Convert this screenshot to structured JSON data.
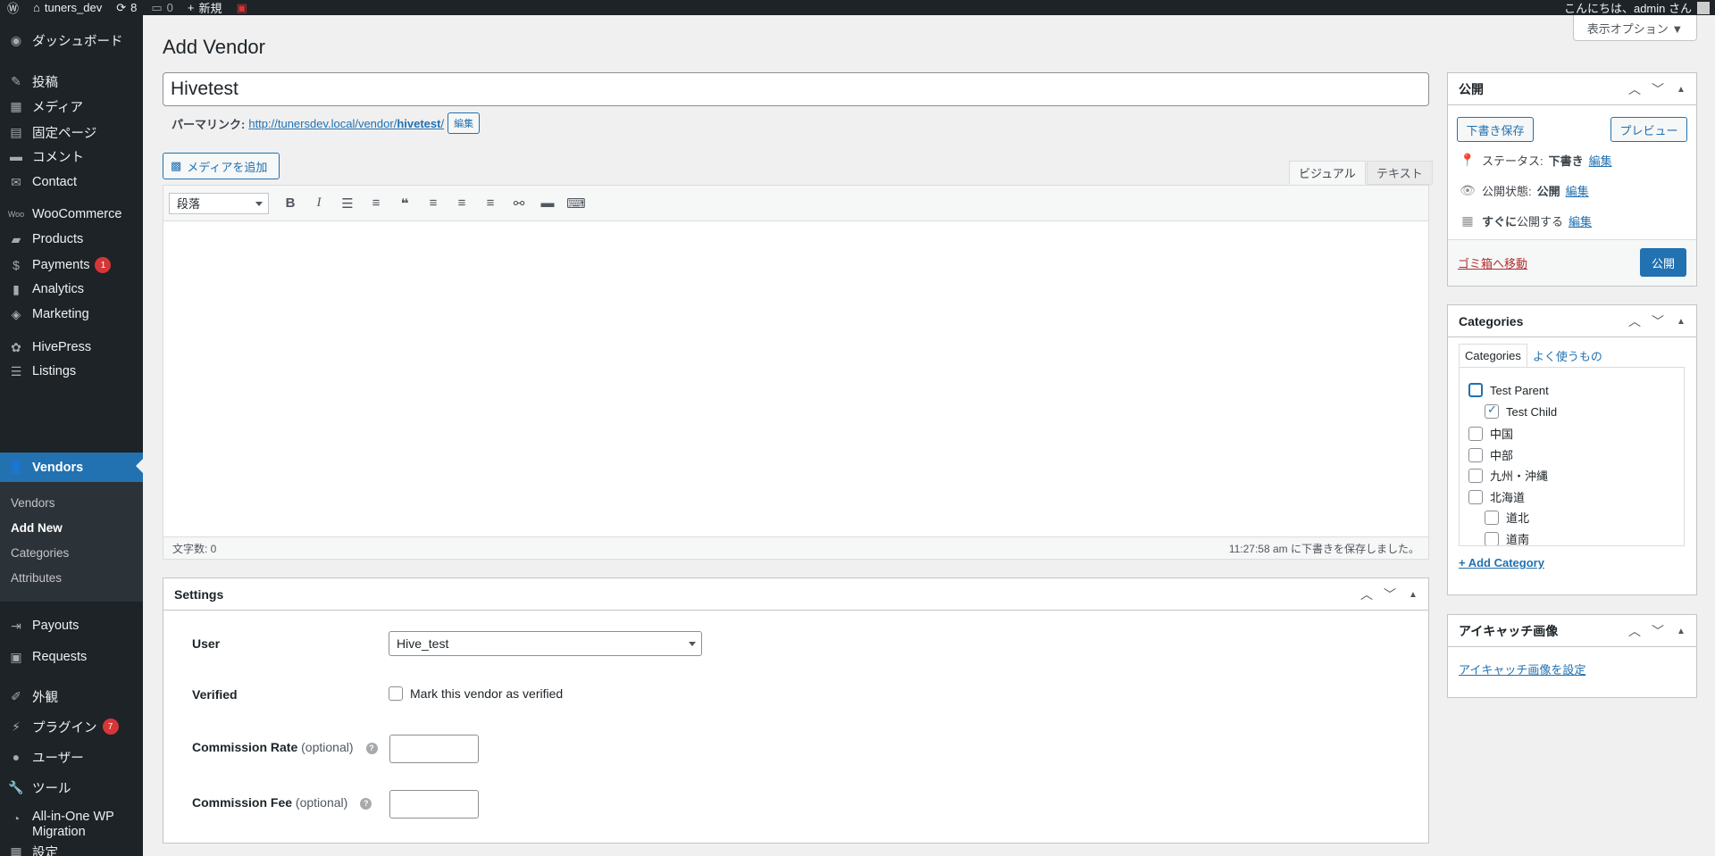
{
  "admin_bar": {
    "site_name": "tuners_dev",
    "updates": "8",
    "comments": "0",
    "new_label": "新規",
    "greeting": "こんにちは、admin さん"
  },
  "sidebar": {
    "items": [
      {
        "label": "ダッシュボード",
        "icon": "dashboard-icon"
      },
      {
        "label": "投稿",
        "icon": "pin-icon"
      },
      {
        "label": "メディア",
        "icon": "media-icon"
      },
      {
        "label": "固定ページ",
        "icon": "page-icon"
      },
      {
        "label": "コメント",
        "icon": "comment-icon"
      },
      {
        "label": "Contact",
        "icon": "mail-icon"
      },
      {
        "label": "WooCommerce",
        "icon": "woo-icon"
      },
      {
        "label": "Products",
        "icon": "products-icon"
      },
      {
        "label": "Payments",
        "icon": "payments-icon",
        "badge": "1"
      },
      {
        "label": "Analytics",
        "icon": "analytics-icon"
      },
      {
        "label": "Marketing",
        "icon": "marketing-icon"
      },
      {
        "label": "HivePress",
        "icon": "hivepress-icon"
      },
      {
        "label": "Listings",
        "icon": "listings-icon"
      },
      {
        "label": "Vendors",
        "icon": "vendors-icon"
      },
      {
        "label": "Payouts",
        "icon": "payouts-icon"
      },
      {
        "label": "Requests",
        "icon": "requests-icon"
      },
      {
        "label": "外観",
        "icon": "appearance-icon"
      },
      {
        "label": "プラグイン",
        "icon": "plugins-icon",
        "badge": "7"
      },
      {
        "label": "ユーザー",
        "icon": "users-icon"
      },
      {
        "label": "ツール",
        "icon": "tools-icon"
      },
      {
        "label": "All-in-One WP",
        "label2": "Migration",
        "icon": "migration-icon"
      },
      {
        "label": "設定",
        "icon": "settings-icon"
      }
    ],
    "submenu": [
      "Vendors",
      "Add New",
      "Categories",
      "Attributes"
    ]
  },
  "screen_options": "表示オプション ▼",
  "page_title": "Add Vendor",
  "title_value": "Hivetest",
  "permalink": {
    "label": "パーマリンク:",
    "url_prefix": "http://tunersdev.local/vendor/",
    "slug": "hivetest",
    "url_suffix": "/",
    "edit": "編集"
  },
  "add_media": "メディアを追加",
  "editor": {
    "tab_visual": "ビジュアル",
    "tab_text": "テキスト",
    "format": "段落",
    "word_count": "文字数: 0",
    "saved_msg": "11:27:58 am に下書きを保存しました。"
  },
  "settings": {
    "title": "Settings",
    "user_label": "User",
    "user_value": "Hive_test",
    "verified_label": "Verified",
    "verified_text": "Mark this vendor as verified",
    "rate_label": "Commission Rate",
    "fee_label": "Commission Fee",
    "optional": "(optional)"
  },
  "publish": {
    "title": "公開",
    "save_draft": "下書き保存",
    "preview": "プレビュー",
    "status_label": "ステータス:",
    "status_value": "下書き",
    "visibility_label": "公開状態:",
    "visibility_value": "公開",
    "schedule_bold": "すぐに",
    "schedule_rest": "公開する",
    "edit": "編集",
    "trash": "ゴミ箱へ移動",
    "publish_btn": "公開"
  },
  "categories": {
    "title": "Categories",
    "tab_all": "Categories",
    "tab_popular": "よく使うもの",
    "items": [
      {
        "label": "Test Parent",
        "checked": false,
        "level": 0
      },
      {
        "label": "Test Child",
        "checked": true,
        "level": 1
      },
      {
        "label": "中国",
        "checked": false,
        "level": 0
      },
      {
        "label": "中部",
        "checked": false,
        "level": 0
      },
      {
        "label": "九州・沖縄",
        "checked": false,
        "level": 0
      },
      {
        "label": "北海道",
        "checked": false,
        "level": 0
      },
      {
        "label": "道北",
        "checked": false,
        "level": 1
      },
      {
        "label": "道南",
        "checked": false,
        "level": 1
      }
    ],
    "add": "+ Add Category"
  },
  "featured_image": {
    "title": "アイキャッチ画像",
    "link": "アイキャッチ画像を設定"
  }
}
